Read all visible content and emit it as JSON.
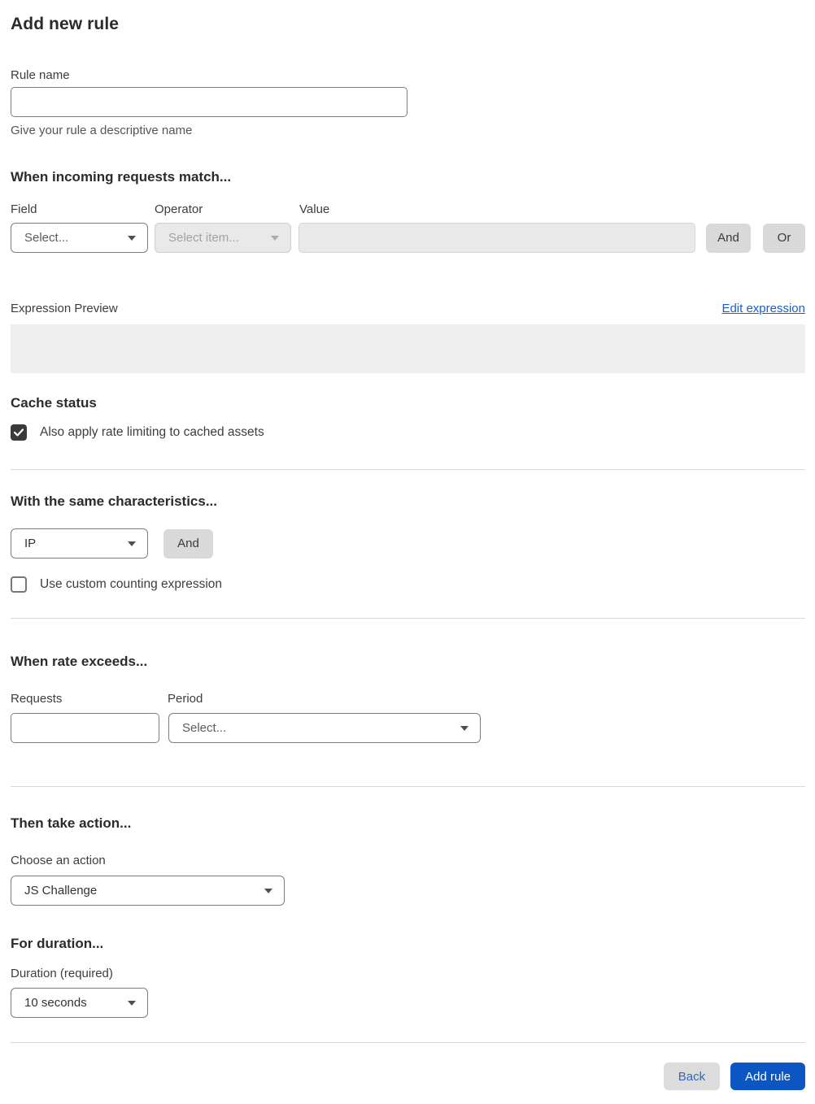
{
  "page": {
    "title": "Add new rule"
  },
  "rule_name": {
    "label": "Rule name",
    "value": "",
    "helper": "Give your rule a descriptive name"
  },
  "match_section": {
    "heading": "When incoming requests match...",
    "field": {
      "label": "Field",
      "selected": "Select..."
    },
    "operator": {
      "label": "Operator",
      "selected": "Select item...",
      "disabled": true
    },
    "value": {
      "label": "Value",
      "value": "",
      "disabled": true
    },
    "and_button": "And",
    "or_button": "Or",
    "expression_preview_label": "Expression Preview",
    "edit_expression_link": "Edit expression",
    "expression_value": ""
  },
  "cache_section": {
    "heading": "Cache status",
    "checkbox_label": "Also apply rate limiting to cached assets",
    "checked": true
  },
  "characteristics_section": {
    "heading": "With the same characteristics...",
    "characteristic": {
      "selected": "IP"
    },
    "and_button": "And",
    "checkbox_label": "Use custom counting expression",
    "checked": false
  },
  "rate_section": {
    "heading": "When rate exceeds...",
    "requests": {
      "label": "Requests",
      "value": ""
    },
    "period": {
      "label": "Period",
      "selected": "Select..."
    }
  },
  "action_section": {
    "heading": "Then take action...",
    "label": "Choose an action",
    "selected": "JS Challenge"
  },
  "duration_section": {
    "heading": "For duration...",
    "label": "Duration (required)",
    "selected": "10 seconds"
  },
  "footer": {
    "back_button": "Back",
    "add_rule_button": "Add rule"
  },
  "colors": {
    "primary_blue": "#0b56c3",
    "link_blue": "#1a5ecb",
    "button_gray": "#d9d9d9",
    "disabled_bg": "#e9e9e9",
    "divider": "#d9d9d9",
    "checkbox_checked": "#3a3a3a"
  }
}
